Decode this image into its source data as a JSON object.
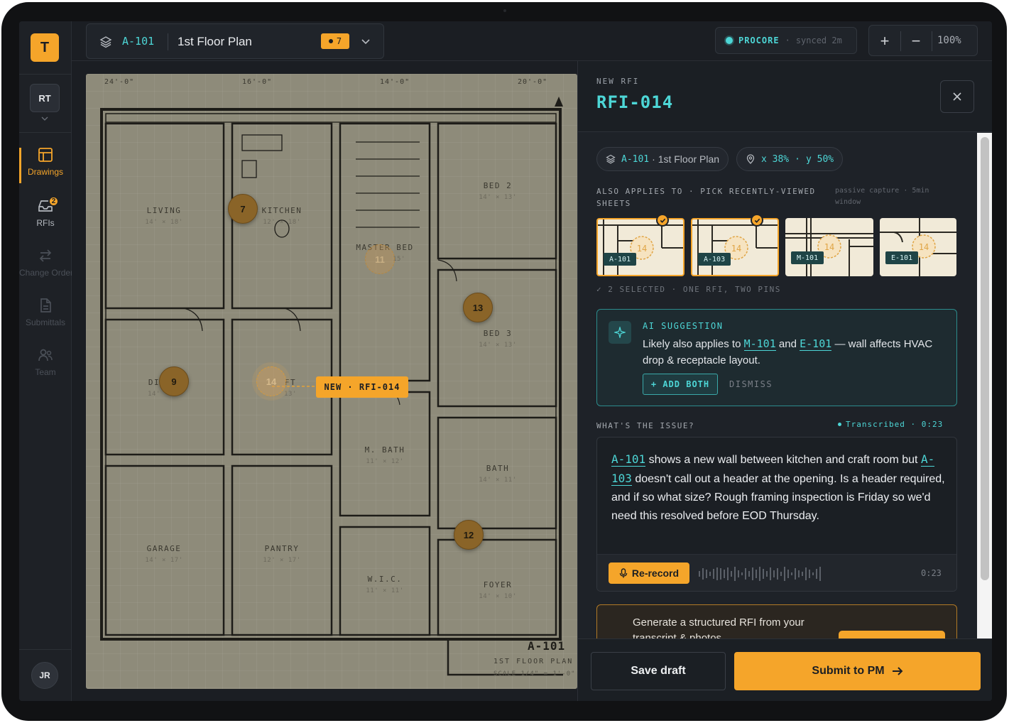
{
  "app": {
    "logo_letter": "T"
  },
  "sidebar": {
    "project_initials": "RT",
    "items": [
      {
        "label": "Drawings",
        "icon": "drawings-icon",
        "active": true
      },
      {
        "label": "RFIs",
        "icon": "inbox-icon",
        "badge": "2"
      },
      {
        "label": "Change Orders",
        "icon": "swap-icon"
      },
      {
        "label": "Submittals",
        "icon": "document-icon"
      },
      {
        "label": "Team",
        "icon": "team-icon"
      }
    ],
    "user_initials": "JR"
  },
  "topbar": {
    "sheet_code": "A-101",
    "sheet_name": "1st Floor Plan",
    "pin_count": "7",
    "sync": {
      "name": "PROCORE",
      "separator": "·",
      "status": "synced 2m"
    },
    "zoom": {
      "plus": "+",
      "minus": "−",
      "value": "100%"
    }
  },
  "drawing": {
    "dimensions": [
      "24'-0\"",
      "16'-0\"",
      "14'-0\"",
      "20'-0\""
    ],
    "rooms": [
      {
        "name": "LIVING",
        "size": "14' × 18'"
      },
      {
        "name": "KITCHEN",
        "size": "12' × 18'"
      },
      {
        "name": "MASTER BED",
        "size": "15'"
      },
      {
        "name": "BED 2",
        "size": "14' × 13'"
      },
      {
        "name": "BED 3",
        "size": "14' × 13'"
      },
      {
        "name": "DI",
        "size": "14'"
      },
      {
        "name": "FT",
        "size": "13'"
      },
      {
        "name": "M. BATH",
        "size": "11' × 12'"
      },
      {
        "name": "BATH",
        "size": "14' × 11'"
      },
      {
        "name": "GARAGE",
        "size": "14' × 17'"
      },
      {
        "name": "PANTRY",
        "size": "12' × 17'"
      },
      {
        "name": "W.I.C.",
        "size": "11' × 11'"
      },
      {
        "name": "FOYER",
        "size": "14' × 10'"
      }
    ],
    "pins": [
      "7",
      "11",
      "13",
      "9",
      "14",
      "12"
    ],
    "new_tag": "NEW · RFI-014",
    "title_code": "A-101",
    "title_name": "1ST FLOOR PLAN",
    "title_scale": "SCALE 1/4\" = 1'-0\""
  },
  "rfi": {
    "kicker": "NEW RFI",
    "id": "RFI-014",
    "location_chip": {
      "code": "A-101",
      "name": "· 1st Floor Plan"
    },
    "coord_chip": {
      "x": "x 38%",
      "sep": "·",
      "y": "y 50%"
    },
    "also_applies_label": "ALSO APPLIES TO · PICK RECENTLY-VIEWED SHEETS",
    "passive_note": "passive capture · 5min window",
    "thumbnails": [
      {
        "code": "A-101",
        "pin": "14",
        "selected": true
      },
      {
        "code": "A-103",
        "pin": "14",
        "selected": true
      },
      {
        "code": "M-101",
        "pin": "14",
        "selected": false
      },
      {
        "code": "E-101",
        "pin": "14",
        "selected": false
      }
    ],
    "selected_note": "✓ 2 SELECTED · ONE RFI, TWO PINS",
    "ai": {
      "kicker": "AI SUGGESTION",
      "text_1": "Likely also applies to ",
      "link_1": "M-101",
      "text_2": " and ",
      "link_2": "E-101",
      "text_3": " — wall affects HVAC drop & receptacle layout.",
      "add_label": "+ ADD BOTH",
      "dismiss_label": "DISMISS"
    },
    "issue": {
      "label": "WHAT'S THE ISSUE?",
      "transcribed": "Transcribed · 0:23",
      "link_1": "A-101",
      "text_1": " shows a new wall between kitchen and craft room but ",
      "link_2": "A-103",
      "text_2": " doesn't call out a header at the opening. Is a header required, and if so what size? Rough framing inspection is Friday so we'd need this resolved before EOD Thursday.",
      "rerecord_label": "Re-record",
      "duration": "0:23"
    },
    "generate": {
      "text": "Generate a structured RFI from your transcript & photos"
    },
    "footer": {
      "save_label": "Save draft",
      "submit_label": "Submit to PM"
    }
  },
  "colors": {
    "accent": "#f5a52a",
    "teal": "#4dd6d6",
    "bg": "#1b1e23"
  }
}
